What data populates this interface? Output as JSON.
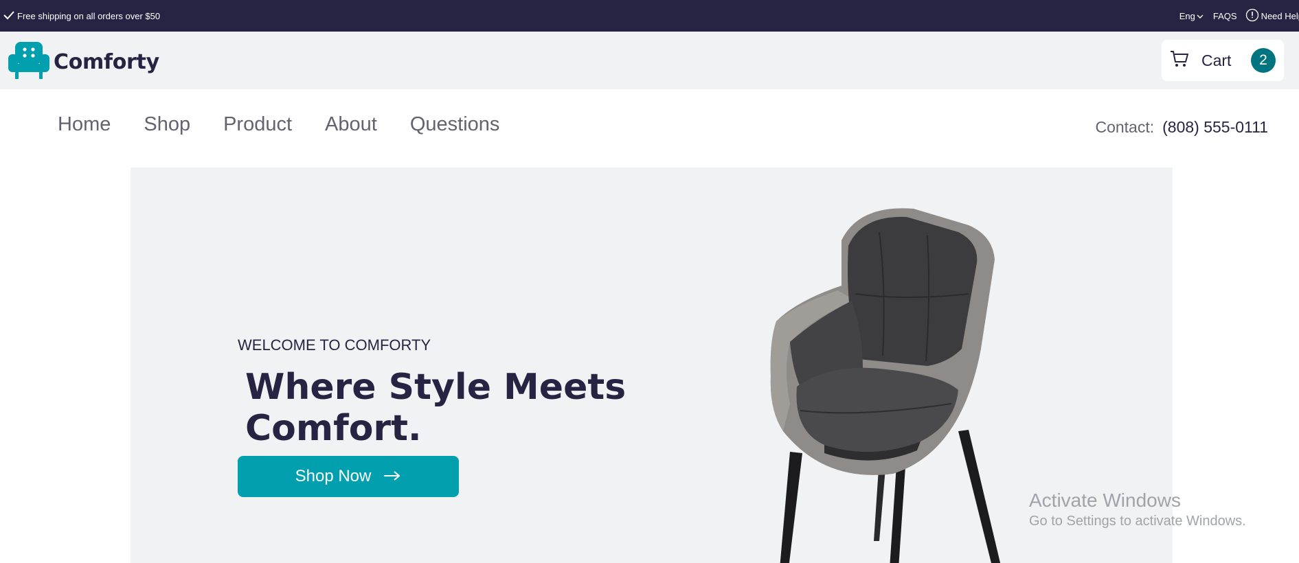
{
  "topbar": {
    "announcement": "Free shipping on all orders over $50",
    "language": "Eng",
    "faqs": "FAQS",
    "help": "Need Help"
  },
  "header": {
    "brand": "Comforty",
    "cart_label": "Cart",
    "cart_count": "2"
  },
  "nav": {
    "items": [
      "Home",
      "Shop",
      "Product",
      "About",
      "Questions"
    ],
    "contact_label": "Contact:",
    "contact_phone": "(808) 555-0111"
  },
  "hero": {
    "eyebrow": "WELCOME TO COMFORTY",
    "headline_line1": "Where Style Meets",
    "headline_line2": "Comfort.",
    "cta": "Shop Now"
  },
  "watermark": {
    "title": "Activate Windows",
    "subtitle": "Go to Settings to activate Windows."
  },
  "colors": {
    "navy": "#272343",
    "teal_button": "#029fae",
    "teal_badge": "#007580",
    "light_gray": "#f0f2f3",
    "muted_text": "#636270"
  },
  "icons": [
    "check-icon",
    "chevron-down-icon",
    "info-icon",
    "sofa-logo-icon",
    "cart-icon",
    "arrow-right-icon"
  ]
}
